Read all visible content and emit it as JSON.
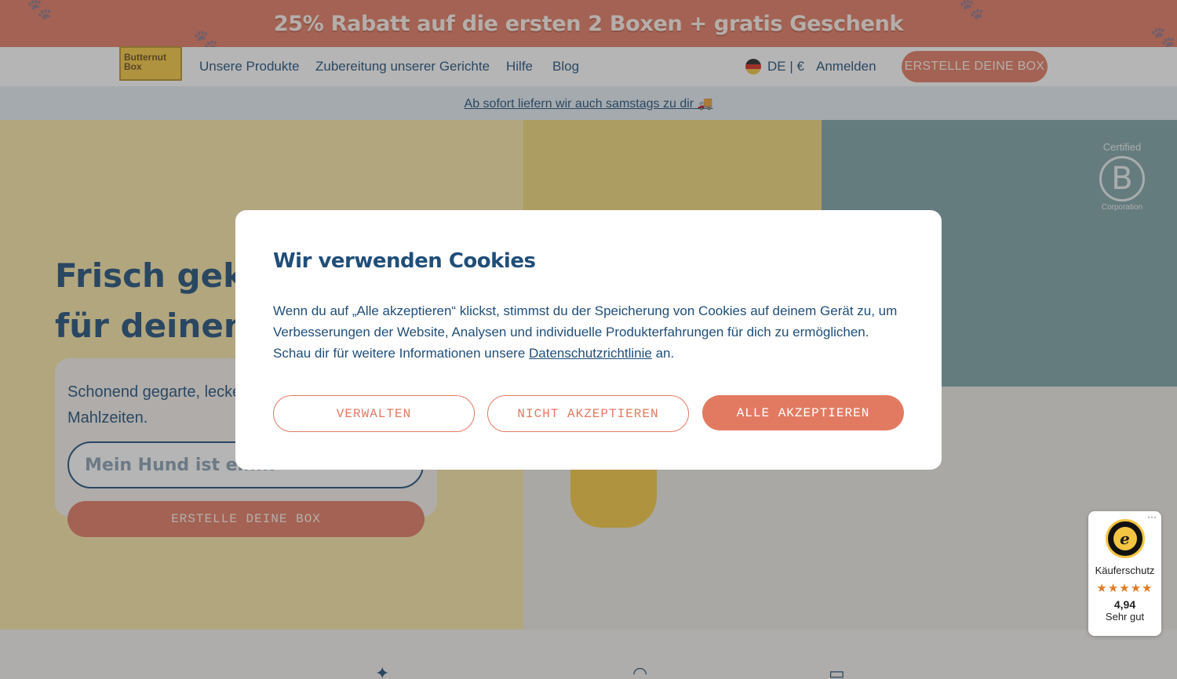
{
  "promo": {
    "text": "25% Rabatt auf die ersten 2 Boxen + gratis Geschenk"
  },
  "brand": {
    "logo_text_1": "Butternut",
    "logo_text_2": "Box"
  },
  "nav": {
    "links": [
      "Unsere Produkte",
      "Zubereitung unserer Gerichte",
      "Hilfe",
      "Blog"
    ],
    "language": "DE | €",
    "login": "Anmelden",
    "cta": "ERSTELLE DEINE BOX"
  },
  "delivery": {
    "text": "Ab sofort liefern wir auch samstags zu dir 🚚"
  },
  "hero": {
    "title_line_1": "Frisch geko",
    "title_line_2": "für deinen H",
    "subtitle": "Schonend gegarte, lecke",
    "subtitle_2": "Mahlzeiten.",
    "input_placeholder": "Mein Hund ist ein...",
    "cta": "ERSTELLE DEINE BOX"
  },
  "bcorp": {
    "top": "Certified",
    "letter": "B",
    "bottom": "Corporation"
  },
  "cookie_modal": {
    "title": "Wir verwenden Cookies",
    "body_before": "Wenn du auf „Alle akzeptieren“ klickst, stimmst du der Speicherung von Cookies auf deinem Gerät zu, um Verbesserungen der Website, Analysen und individuelle Produkterfahrungen für dich zu ermöglichen. Schau dir für weitere Informationen unsere ",
    "body_link": "Datenschutzrichtlinie",
    "body_after": " an.",
    "buttons": {
      "manage": "VERWALTEN",
      "reject": "NICHT AKZEPTIEREN",
      "accept": "ALLE AKZEPTIEREN"
    }
  },
  "trusted_shops": {
    "menu": "···",
    "seal_letter": "e",
    "label": "Käuferschutz",
    "stars": "★★★★★",
    "score": "4,94",
    "rating_text": "Sehr gut"
  },
  "colors": {
    "accent": "#e27a62",
    "navy": "#1f4e79",
    "hero_bg": "#fbe7a8"
  }
}
